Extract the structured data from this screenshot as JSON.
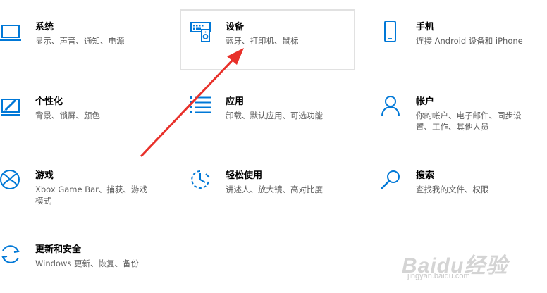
{
  "colors": {
    "accent": "#0078d7",
    "arrow": "#e8302a"
  },
  "tiles": {
    "system": {
      "title": "系统",
      "desc": "显示、声音、通知、电源",
      "icon": "laptop-icon"
    },
    "devices": {
      "title": "设备",
      "desc": "蓝牙、打印机、鼠标",
      "icon": "devices-icon"
    },
    "phone": {
      "title": "手机",
      "desc": "连接 Android 设备和 iPhone",
      "icon": "phone-icon"
    },
    "personal": {
      "title": "个性化",
      "desc": "背景、锁屏、颜色",
      "icon": "personalization-icon"
    },
    "apps": {
      "title": "应用",
      "desc": "卸载、默认应用、可选功能",
      "icon": "apps-list-icon"
    },
    "accounts": {
      "title": "帐户",
      "desc": "你的帐户、电子邮件、同步设置、工作、其他人员",
      "icon": "person-icon"
    },
    "gaming": {
      "title": "游戏",
      "desc": "Xbox Game Bar、捕获、游戏模式",
      "icon": "xbox-icon"
    },
    "ease": {
      "title": "轻松使用",
      "desc": "讲述人、放大镜、高对比度",
      "icon": "ease-of-access-icon"
    },
    "search": {
      "title": "搜索",
      "desc": "查找我的文件、权限",
      "icon": "search-icon"
    },
    "update": {
      "title": "更新和安全",
      "desc": "Windows 更新、恢复、备份",
      "icon": "update-icon"
    }
  },
  "watermark": {
    "brand": "Baidu经验",
    "url": "jingyan.baidu.com"
  }
}
